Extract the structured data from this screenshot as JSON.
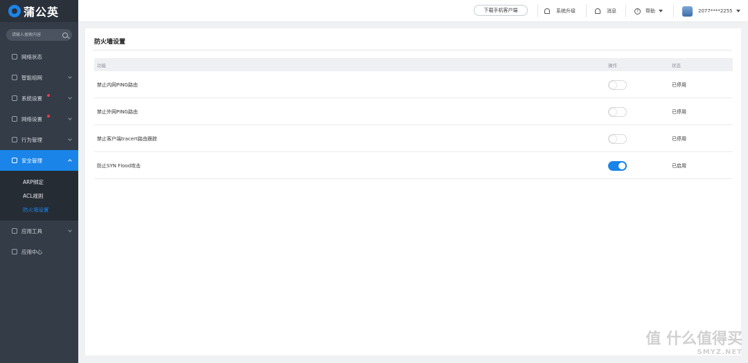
{
  "brand": {
    "name": "蒲公英"
  },
  "search": {
    "placeholder": "请输入搜索内容"
  },
  "sidebar": {
    "items": [
      {
        "label": "网络状态"
      },
      {
        "label": "智能组网"
      },
      {
        "label": "系统设置"
      },
      {
        "label": "网络设置"
      },
      {
        "label": "行为管理"
      },
      {
        "label": "安全管理"
      },
      {
        "label": "应用工具"
      },
      {
        "label": "应用中心"
      }
    ],
    "sub_items": [
      {
        "label": "ARP绑定"
      },
      {
        "label": "ACL规则"
      },
      {
        "label": "防火墙设置"
      }
    ]
  },
  "header": {
    "download": "下载手机客户端",
    "upgrade": "系统升级",
    "messages": "消息",
    "help": "帮助",
    "user": "2077****2255"
  },
  "page": {
    "title": "防火墙设置",
    "columns": {
      "function": "功能",
      "action": "操作",
      "status": "状态"
    },
    "rows": [
      {
        "label": "禁止内网PING路由",
        "enabled": false,
        "status": "已停用"
      },
      {
        "label": "禁止外网PING路由",
        "enabled": false,
        "status": "已停用"
      },
      {
        "label": "禁止客户端tracert路由跟踪",
        "enabled": false,
        "status": "已停用"
      },
      {
        "label": "防止SYN Flood攻击",
        "enabled": true,
        "status": "已启用"
      }
    ]
  },
  "watermark": {
    "main": "值 什么值得买",
    "sub": "SMYZ.NET"
  },
  "colors": {
    "accent": "#1a84e8",
    "sidebar": "#343c47",
    "badge": "#f0384a"
  }
}
